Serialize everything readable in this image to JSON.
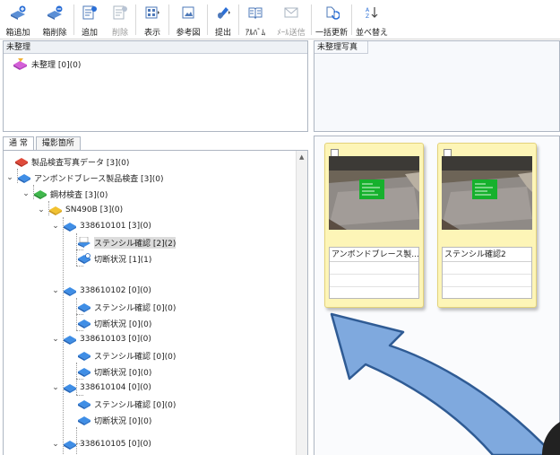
{
  "toolbar": {
    "items": [
      {
        "label": "箱追加",
        "icon": "add-box-icon",
        "disabled": false
      },
      {
        "label": "箱削除",
        "icon": "delete-box-icon",
        "disabled": false
      },
      {
        "label": "追加",
        "icon": "add-document-icon",
        "disabled": false
      },
      {
        "label": "削除",
        "icon": "delete-document-icon",
        "disabled": true
      },
      {
        "label": "表示",
        "icon": "display-icon",
        "disabled": false
      },
      {
        "label": "参考図",
        "icon": "reference-image-icon",
        "disabled": false
      },
      {
        "label": "提出",
        "icon": "submit-icon",
        "disabled": false
      },
      {
        "label": "ｱﾙﾊﾞﾑ",
        "icon": "album-icon",
        "disabled": false
      },
      {
        "label": "ﾒｰﾙ送信",
        "icon": "mail-icon",
        "disabled": true
      },
      {
        "label": "一括更新",
        "icon": "bulk-update-icon",
        "disabled": false
      },
      {
        "label": "並べ替え",
        "icon": "sort-icon",
        "disabled": false
      }
    ]
  },
  "unsorted_panel": {
    "title": "未整理",
    "item_label": "未整理 [0](0)"
  },
  "unsorted_photos_panel": {
    "title": "未整理写真"
  },
  "tabs": {
    "normal": "通 常",
    "location": "撮影箇所"
  },
  "tree": {
    "root": "製品検査写真データ [3](0)",
    "n1": "アンボンドブレース製品検査 [3](0)",
    "n2": "鋼材検査 [3](0)",
    "n3": "SN490B [3](0)",
    "g1": "338610101 [3](0)",
    "g1a": "ステンシル確認 [2](2)",
    "g1b": "切断状況 [1](1)",
    "g2": "338610102 [0](0)",
    "g2a": "ステンシル確認 [0](0)",
    "g2b": "切断状況 [0](0)",
    "g3": "338610103 [0](0)",
    "g3a": "ステンシル確認 [0](0)",
    "g3b": "切断状況 [0](0)",
    "g4": "338610104 [0](0)",
    "g4a": "ステンシル確認 [0](0)",
    "g4b": "切断状況 [0](0)",
    "g5": "338610105 [0](0)"
  },
  "photos": [
    {
      "caption": "アンボンドブレース製..."
    },
    {
      "caption": "ステンシル確認2"
    }
  ],
  "colors": {
    "arrow_fill": "#7fa9de",
    "arrow_stroke": "#2f5b94",
    "card_bg": "#fdf5b7",
    "panel_border": "#aeb6c2"
  }
}
